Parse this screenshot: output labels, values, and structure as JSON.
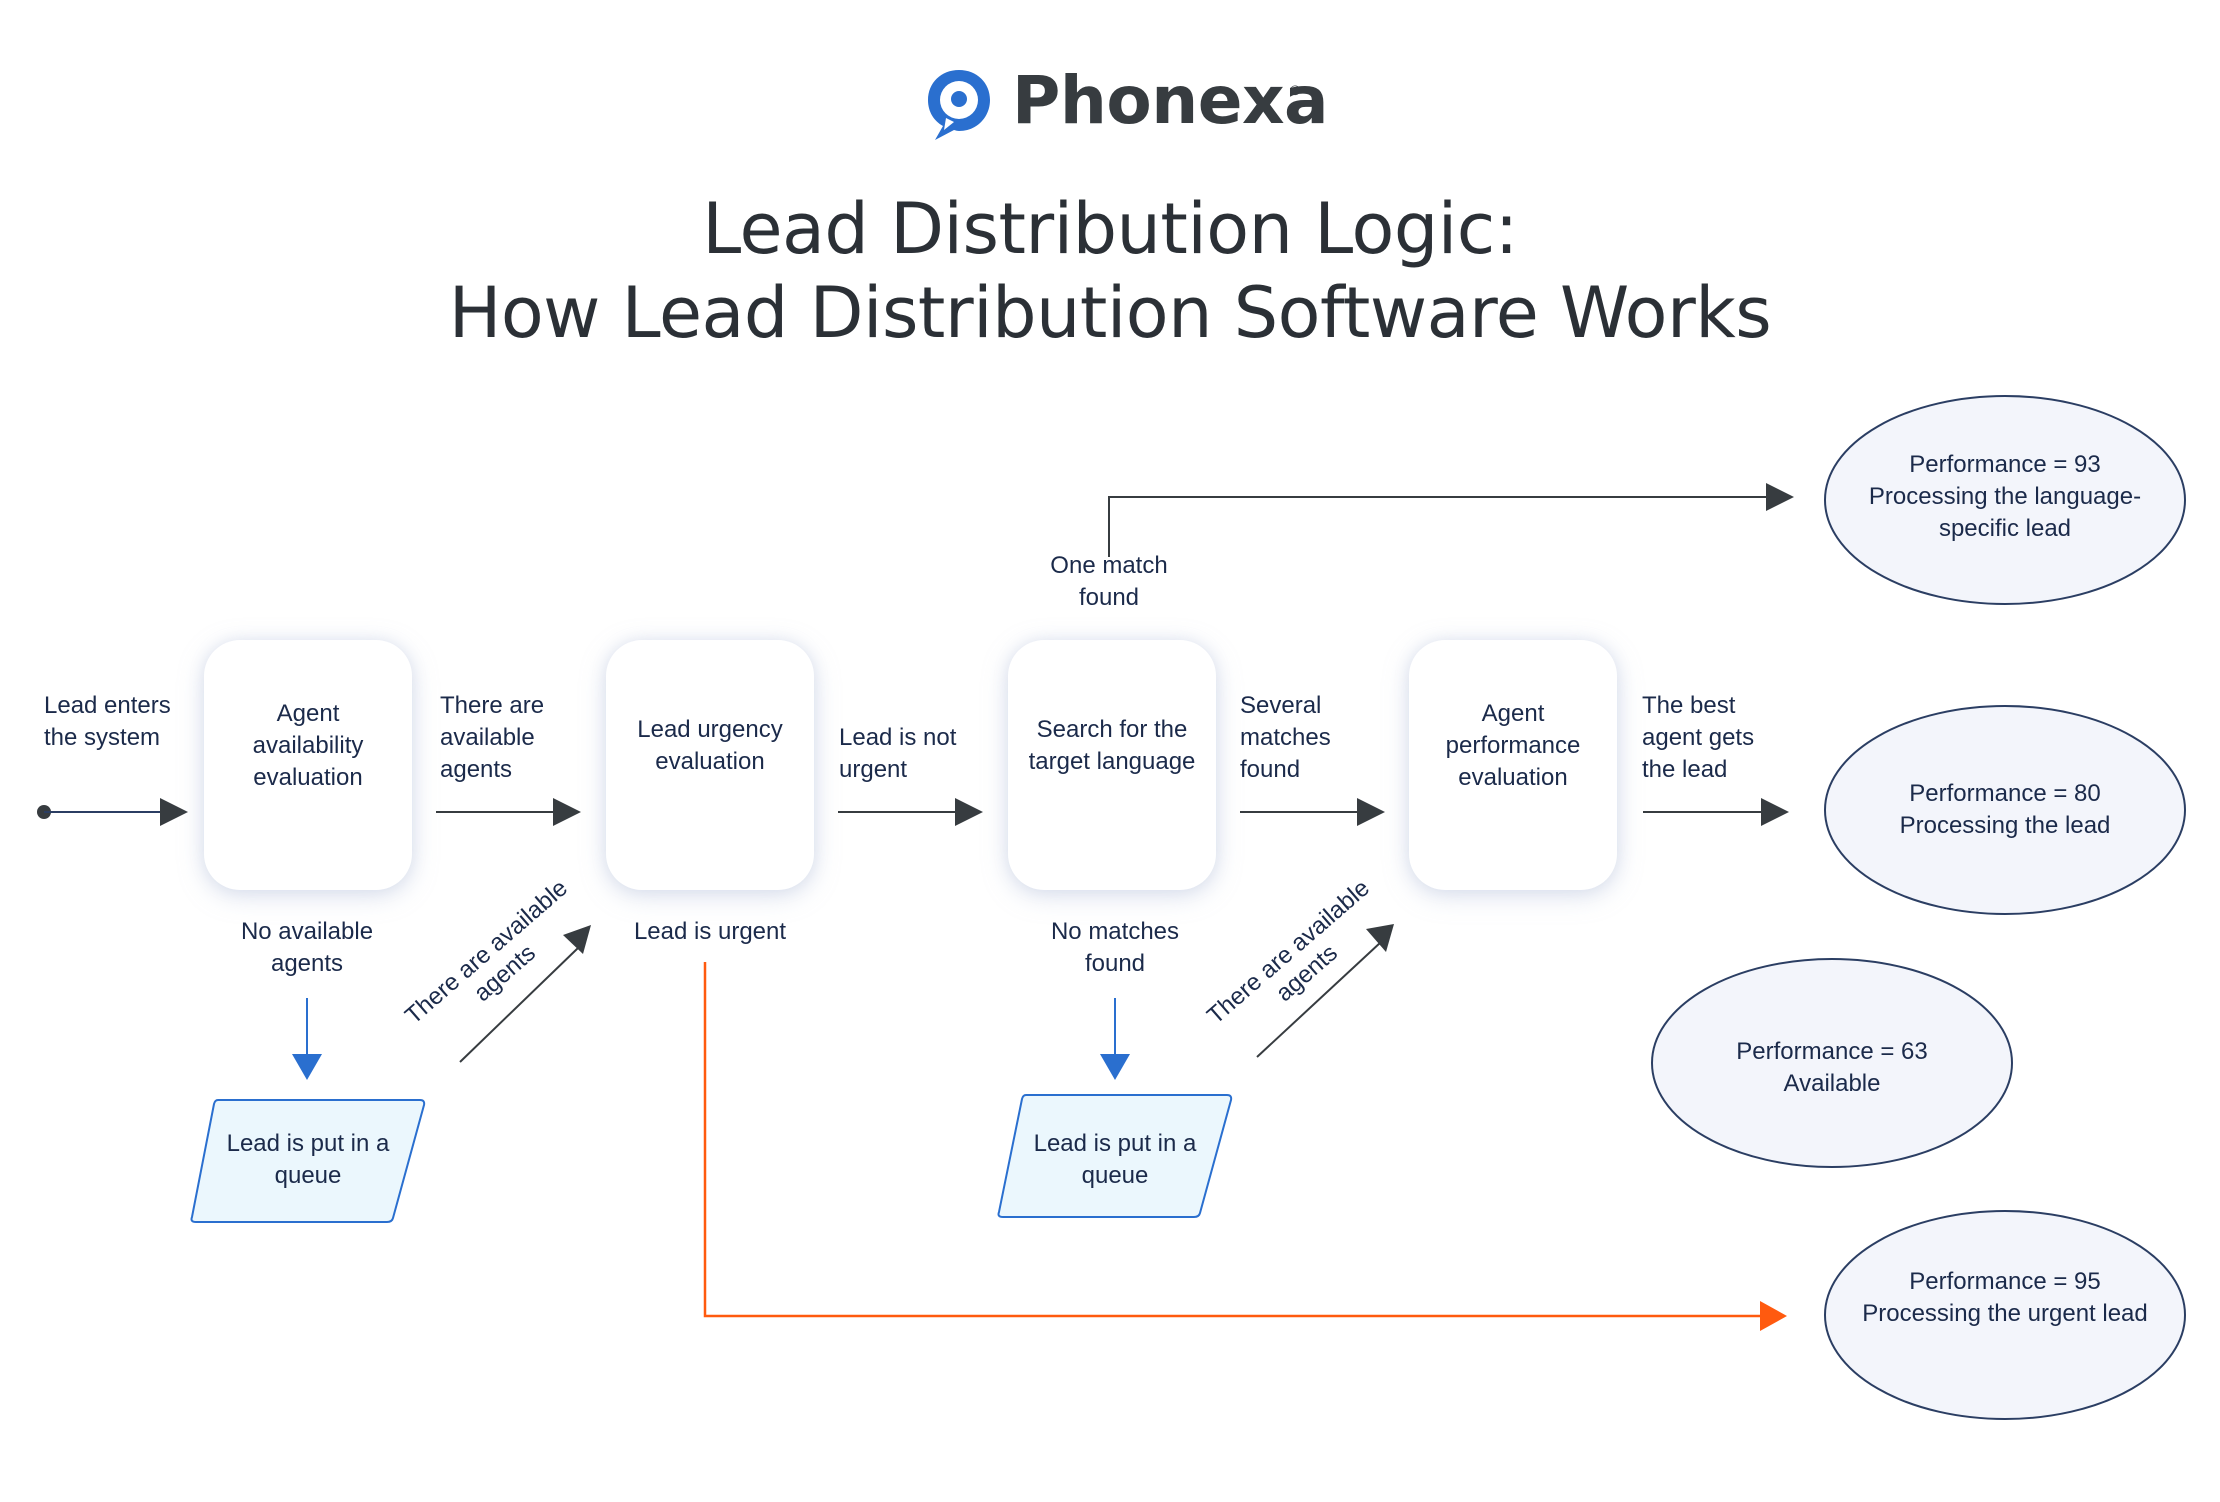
{
  "brand": {
    "name": "Phonexa",
    "registered_mark": "®",
    "icon": "speech-bubble-pin-icon",
    "color": "#2a6fcf"
  },
  "title": {
    "line1": "Lead Distribution Logic:",
    "line2": "How Lead Distribution Software Works"
  },
  "colors": {
    "text": "#1b2a4a",
    "arrow": "#373c40",
    "queue_arrow": "#2a6fcf",
    "urgent_arrow": "#ff5a0f",
    "queue_fill": "#ebf7fd",
    "queue_border": "#2a6fcf",
    "ellipse_fill": "#f3f5fb",
    "ellipse_border": "#2b3e63"
  },
  "flow": {
    "start_label": "Lead enters the system",
    "steps": [
      {
        "id": "agent-availability",
        "label": "Agent availability evaluation"
      },
      {
        "id": "lead-urgency",
        "label": "Lead urgency evaluation"
      },
      {
        "id": "language-search",
        "label": "Search for the target language"
      },
      {
        "id": "agent-performance",
        "label": "Agent performance evaluation"
      }
    ],
    "edge_labels": {
      "available_agents": "There are available agents",
      "not_urgent": "Lead is not urgent",
      "several_matches": "Several matches found",
      "best_agent": "The best agent gets the lead",
      "one_match": "One match found",
      "no_agents": "No available agents",
      "urgent": "Lead is urgent",
      "no_matches": "No matches found",
      "diag_available_1": "There are available agents",
      "diag_available_2": "There are available agents"
    },
    "queues": [
      {
        "label": "Lead is put in a queue"
      },
      {
        "label": "Lead is put in a queue"
      }
    ]
  },
  "agents": [
    {
      "line1": "Performance = 93",
      "line2": "Processing the language-specific lead"
    },
    {
      "line1": "Performance = 80",
      "line2": "Processing the lead"
    },
    {
      "line1": "Performance = 63",
      "line2": "Available"
    },
    {
      "line1": "Performance = 95",
      "line2": "Processing the urgent lead"
    }
  ]
}
